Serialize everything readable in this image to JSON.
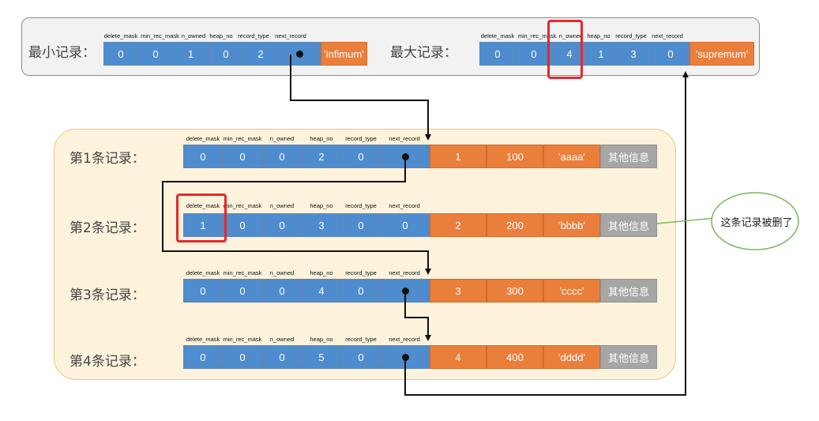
{
  "top": {
    "min_label": "最小记录：",
    "max_label": "最大记录：",
    "min_headers": [
      "delete_mask",
      "min_rec_mask",
      "n_owned",
      "heap_no",
      "record_type",
      "next_record"
    ],
    "max_headers": [
      "delete_mask",
      "min_rec_mask",
      "n_owned",
      "heap_no",
      "record_type",
      "next_record"
    ],
    "min_values": [
      "0",
      "0",
      "1",
      "0",
      "2",
      ""
    ],
    "max_values": [
      "0",
      "0",
      "4",
      "1",
      "3",
      "0"
    ],
    "min_data": "'infimum'",
    "max_data": "'supremum'"
  },
  "records": [
    {
      "label": "第1条记录：",
      "values": [
        "0",
        "0",
        "0",
        "2",
        "0",
        ""
      ],
      "data": [
        "1",
        "100",
        "'aaaa'"
      ],
      "other": "其他信息"
    },
    {
      "label": "第2条记录：",
      "values": [
        "1",
        "0",
        "0",
        "3",
        "0",
        "0"
      ],
      "data": [
        "2",
        "200",
        "'bbbb'"
      ],
      "other": "其他信息"
    },
    {
      "label": "第3条记录：",
      "values": [
        "0",
        "0",
        "0",
        "4",
        "0",
        ""
      ],
      "data": [
        "3",
        "300",
        "'cccc'"
      ],
      "other": "其他信息"
    },
    {
      "label": "第4条记录：",
      "values": [
        "0",
        "0",
        "0",
        "5",
        "0",
        ""
      ],
      "data": [
        "4",
        "400",
        "'dddd'"
      ],
      "other": "其他信息"
    }
  ],
  "record_headers": [
    "delete_mask",
    "min_rec_mask",
    "n_owned",
    "heap_no",
    "record_type",
    "next_record"
  ],
  "callout": "这条记录被删了",
  "colors": {
    "header_field": "#4f8ccd",
    "data_field": "#ea7e3b",
    "other_field": "#a6a6a6",
    "highlight": "#e8272a"
  }
}
